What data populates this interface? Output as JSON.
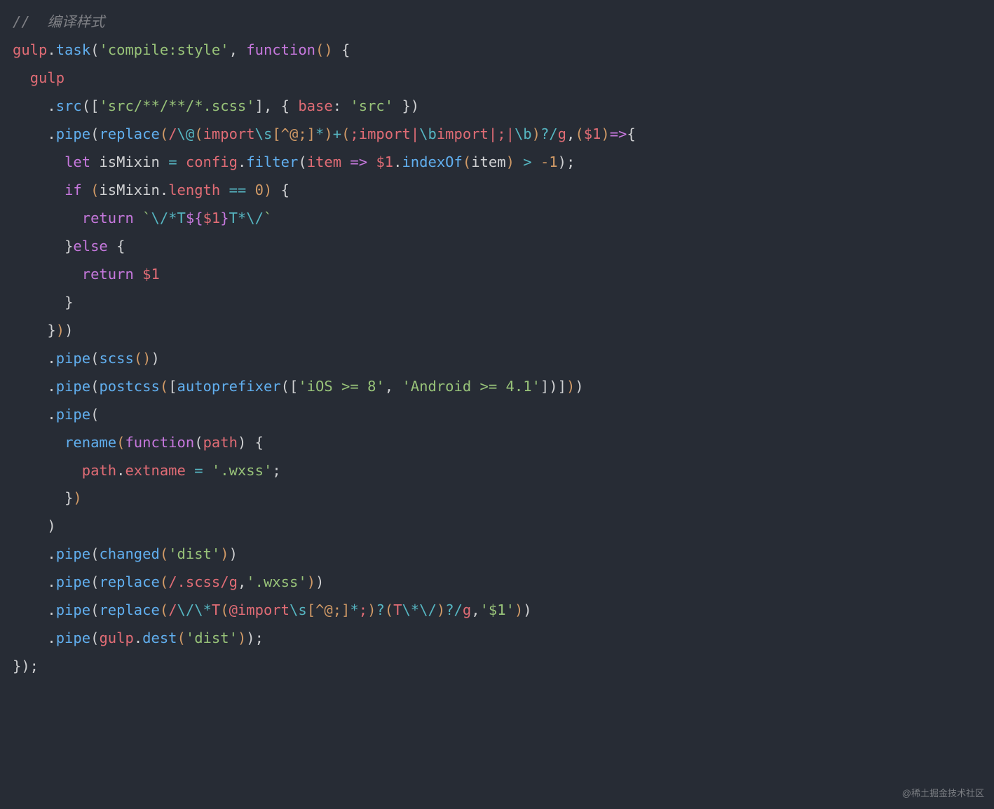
{
  "code": {
    "line1_comment": "//  编译样式",
    "gulp": "gulp",
    "task": "task",
    "taskName": "'compile:style'",
    "functionKw": "function",
    "src": "src",
    "srcGlob": "'src/**/**/*.scss'",
    "baseKey": "base",
    "baseVal": "'src'",
    "pipe": "pipe",
    "replace": "replace",
    "regex1_a": "/",
    "regex1_b": "\\@",
    "regex1_c": "(",
    "regex1_d": "import",
    "regex1_e": "\\s",
    "regex1_f": "[^@;]",
    "regex1_g": "*",
    "regex1_h": ")",
    "regex1_i": "+",
    "regex1_j": "(",
    "regex1_k": ";import",
    "regex1_l": "|",
    "regex1_m": "\\b",
    "regex1_n": "import",
    "regex1_o": "|",
    "regex1_p": ";",
    "regex1_q": "|",
    "regex1_r": "\\b",
    "regex1_s": ")",
    "regex1_t": "?/",
    "regex1_flags": "g",
    "arrowParam": "$1",
    "arrow": "=>",
    "let": "let",
    "isMixin": "isMixin",
    "config": "config",
    "filter": "filter",
    "item": "item",
    "indexOf": "indexOf",
    "gt": ">",
    "minus1": "-1",
    "if": "if",
    "length": "length",
    "eqeq": "==",
    "zero": "0",
    "return": "return",
    "tpl_open": "`",
    "tpl_a": "\\/*T",
    "tpl_b": "${",
    "tpl_c": "$1",
    "tpl_d": "}",
    "tpl_e": "T*\\/",
    "tpl_close": "`",
    "else": "else",
    "scss": "scss",
    "postcss": "postcss",
    "autoprefixer": "autoprefixer",
    "ios": "'iOS >= 8'",
    "android": "'Android >= 4.1'",
    "rename": "rename",
    "path": "path",
    "extname": "extname",
    "wxss": "'.wxss'",
    "changed": "changed",
    "dist": "'dist'",
    "regex2_a": "/",
    "regex2_b": ".scss",
    "regex2_c": "/",
    "regex2_flags": "g",
    "wxss2": "'.wxss'",
    "regex3_a": "/",
    "regex3_b": "\\/\\*",
    "regex3_c": "T",
    "regex3_d": "(",
    "regex3_e": "@import",
    "regex3_f": "\\s",
    "regex3_g": "[^@;]",
    "regex3_h": "*",
    "regex3_i": ";",
    "regex3_j": ")",
    "regex3_k": "?",
    "regex3_l": "(",
    "regex3_m": "T",
    "regex3_n": "\\*\\/",
    "regex3_o": ")",
    "regex3_p": "?/",
    "regex3_flags": "g",
    "dollar1str": "'$1'",
    "dest": "dest"
  },
  "watermark": "@稀土掘金技术社区"
}
